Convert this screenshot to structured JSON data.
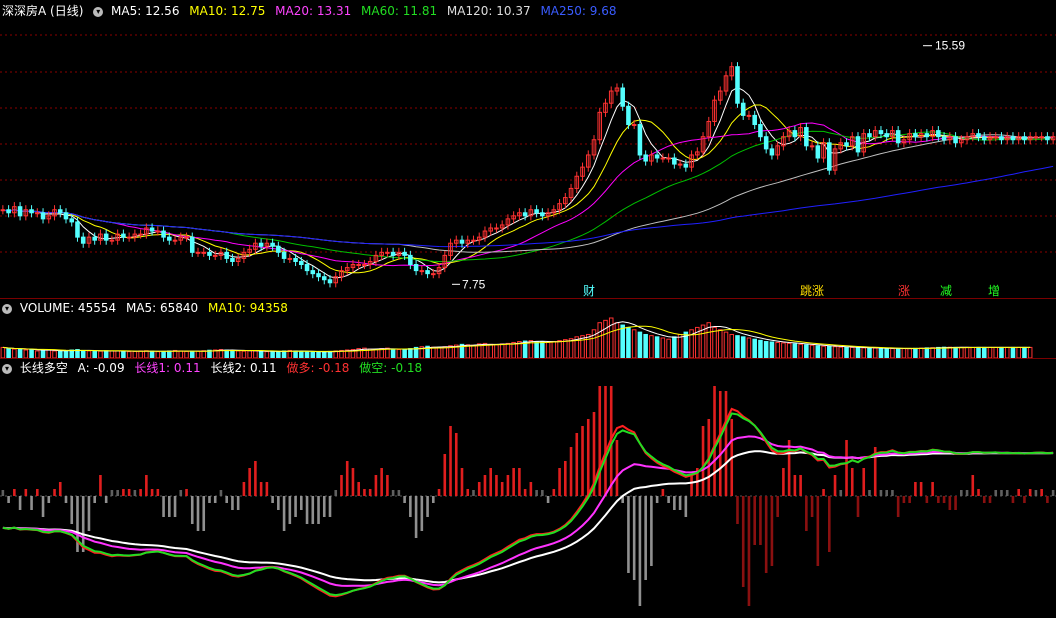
{
  "main_header": {
    "stock_name": "深深房A (日线)",
    "ma5": "MA5: 12.56",
    "ma10": "MA10: 12.75",
    "ma20": "MA20: 13.31",
    "ma60": "MA60: 11.81",
    "ma120": "MA120: 10.37",
    "ma250": "MA250: 9.68"
  },
  "volume_header": {
    "volume": "VOLUME: 45554",
    "ma5": "MA5: 65840",
    "ma10": "MA10: 94358"
  },
  "indicator_header": {
    "name": "长线多空",
    "a": "A: -0.09",
    "line1": "长线1: 0.11",
    "line2": "长线2: 0.11",
    "long": "做多: -0.18",
    "short": "做空: -0.18"
  },
  "annotations": {
    "high_label": "15.59",
    "low_label": "7.75",
    "events": [
      "财",
      "跳涨",
      "涨",
      "减",
      "增"
    ]
  },
  "colors": {
    "up": "#ff3232",
    "down": "#54ffff",
    "ma5": "#ffffff",
    "ma10": "#ffff00",
    "ma20": "#ff00ff",
    "ma60": "#00c000",
    "ma120": "#c0c0c0",
    "ma250": "#2020ff",
    "grid": "#8a0000"
  },
  "chart_data": [
    {
      "type": "candlestick",
      "title": "深深房A (日线)",
      "x": [
        1,
        2,
        3,
        4,
        5,
        6,
        7,
        8,
        9,
        10,
        11,
        12,
        13,
        14,
        15,
        16,
        17,
        18,
        19,
        20,
        21,
        22,
        23,
        24,
        25,
        26,
        27,
        28,
        29,
        30,
        31,
        32,
        33,
        34,
        35,
        36,
        37,
        38,
        39,
        40,
        41,
        42,
        43,
        44,
        45,
        46,
        47,
        48,
        49,
        50,
        51,
        52,
        53,
        54,
        55,
        56,
        57,
        58,
        59,
        60,
        61,
        62,
        63,
        64,
        65,
        66,
        67,
        68,
        69,
        70,
        71,
        72,
        73,
        74,
        75,
        76,
        77,
        78,
        79,
        80,
        81,
        82,
        83,
        84,
        85,
        86,
        87,
        88,
        89,
        90,
        91,
        92,
        93,
        94,
        95,
        96,
        97,
        98,
        99,
        100,
        101,
        102,
        103,
        104,
        105,
        106,
        107,
        108,
        109,
        110,
        111,
        112,
        113,
        114,
        115,
        116,
        117,
        118,
        119,
        120,
        121,
        122,
        123,
        124,
        125,
        126,
        127,
        128,
        129,
        130,
        131,
        132,
        133,
        134,
        135,
        136,
        137,
        138,
        139,
        140,
        141,
        142,
        143,
        144,
        145,
        146,
        147,
        148,
        149,
        150,
        151,
        152,
        153,
        154,
        155,
        156,
        157,
        158,
        159,
        160,
        161,
        162,
        163,
        164,
        165,
        166,
        167,
        168,
        169,
        170,
        171,
        172,
        173,
        174,
        175,
        176,
        177,
        178,
        179,
        180
      ],
      "close": [
        10.2,
        10.1,
        10.3,
        10.0,
        10.2,
        10.1,
        10.1,
        9.9,
        10.0,
        10.2,
        10.1,
        9.9,
        9.8,
        9.3,
        9.1,
        9.3,
        9.2,
        9.4,
        9.2,
        9.2,
        9.4,
        9.3,
        9.3,
        9.4,
        9.4,
        9.6,
        9.5,
        9.5,
        9.3,
        9.2,
        9.2,
        9.3,
        9.3,
        8.8,
        8.8,
        8.8,
        8.7,
        8.7,
        8.8,
        8.6,
        8.5,
        8.6,
        8.8,
        8.9,
        9.1,
        9.0,
        9.1,
        9.0,
        8.8,
        8.6,
        8.6,
        8.5,
        8.4,
        8.2,
        8.1,
        8.0,
        7.9,
        7.8,
        8.0,
        8.2,
        8.3,
        8.4,
        8.4,
        8.4,
        8.5,
        8.7,
        8.8,
        8.8,
        8.7,
        8.8,
        8.7,
        8.4,
        8.2,
        8.2,
        8.1,
        8.1,
        8.3,
        8.7,
        9.1,
        9.2,
        9.1,
        9.2,
        9.2,
        9.3,
        9.5,
        9.6,
        9.6,
        9.7,
        9.9,
        10.0,
        10.1,
        10.0,
        10.2,
        10.1,
        10.0,
        10.1,
        10.2,
        10.4,
        10.6,
        10.9,
        11.3,
        11.6,
        12.0,
        12.5,
        13.4,
        13.7,
        14.1,
        14.2,
        13.6,
        13.0,
        13.0,
        12.0,
        11.8,
        12.0,
        11.9,
        11.9,
        11.9,
        11.7,
        11.7,
        11.6,
        12.0,
        12.1,
        12.6,
        13.1,
        13.8,
        14.1,
        14.6,
        14.9,
        13.7,
        13.3,
        13.3,
        13.0,
        12.6,
        12.2,
        12.0,
        12.3,
        12.6,
        12.8,
        12.6,
        12.9,
        12.3,
        12.3,
        11.9,
        12.4,
        11.5,
        12.2,
        12.4,
        12.3,
        12.6,
        12.1,
        12.7,
        12.6,
        12.8,
        12.7,
        12.6,
        12.8,
        12.4,
        12.5,
        12.7,
        12.6,
        12.7,
        12.6,
        12.8,
        12.6,
        12.5,
        12.6,
        12.4,
        12.5,
        12.6,
        12.7,
        12.6,
        12.5,
        12.6,
        12.6,
        12.5,
        12.6,
        12.5,
        12.6,
        12.5,
        12.6,
        12.6,
        12.6,
        12.5,
        12.6
      ],
      "high_marker": 15.59,
      "low_marker": 7.75,
      "yrange": [
        7.3,
        16.5
      ],
      "ma_labels": [
        "MA5: 12.56",
        "MA10: 12.75",
        "MA20: 13.31",
        "MA60: 11.81",
        "MA120: 10.37",
        "MA250: 9.68"
      ]
    },
    {
      "type": "bar",
      "title": "VOLUME",
      "values": [
        45,
        40,
        38,
        36,
        34,
        36,
        30,
        32,
        35,
        30,
        28,
        30,
        34,
        36,
        32,
        30,
        28,
        29,
        31,
        30,
        30,
        28,
        27,
        28,
        30,
        31,
        29,
        27,
        28,
        30,
        32,
        30,
        28,
        27,
        29,
        31,
        33,
        34,
        36,
        34,
        32,
        30,
        29,
        31,
        30,
        28,
        27,
        26,
        28,
        30,
        32,
        30,
        28,
        27,
        26,
        25,
        27,
        28,
        30,
        32,
        34,
        36,
        40,
        42,
        38,
        36,
        40,
        42,
        38,
        36,
        34,
        40,
        45,
        48,
        50,
        46,
        44,
        48,
        52,
        55,
        58,
        56,
        54,
        60,
        62,
        58,
        56,
        60,
        62,
        66,
        70,
        72,
        74,
        70,
        68,
        66,
        70,
        74,
        78,
        82,
        90,
        95,
        100,
        120,
        150,
        160,
        170,
        150,
        140,
        130,
        120,
        110,
        100,
        95,
        90,
        85,
        80,
        90,
        100,
        110,
        120,
        130,
        140,
        150,
        130,
        120,
        110,
        100,
        95,
        90,
        85,
        80,
        75,
        70,
        68,
        66,
        64,
        62,
        60,
        58,
        56,
        54,
        52,
        50,
        50,
        48,
        46,
        45,
        45,
        44,
        43,
        42,
        42,
        41,
        40,
        40,
        40,
        40,
        40,
        41,
        42,
        43,
        44,
        45,
        46,
        46,
        45,
        45,
        45,
        45,
        45,
        45,
        45,
        45,
        45,
        45,
        45,
        45,
        45,
        45
      ],
      "ma5_label": "MA5: 65840",
      "ma10_label": "MA10: 94358"
    },
    {
      "type": "bar_line",
      "title": "长线多空",
      "series": [
        {
          "name": "A: -0.09"
        },
        {
          "name": "长线1: 0.11"
        },
        {
          "name": "长线2: 0.11"
        },
        {
          "name": "做多: -0.18"
        },
        {
          "name": "做空: -0.18"
        }
      ]
    }
  ]
}
